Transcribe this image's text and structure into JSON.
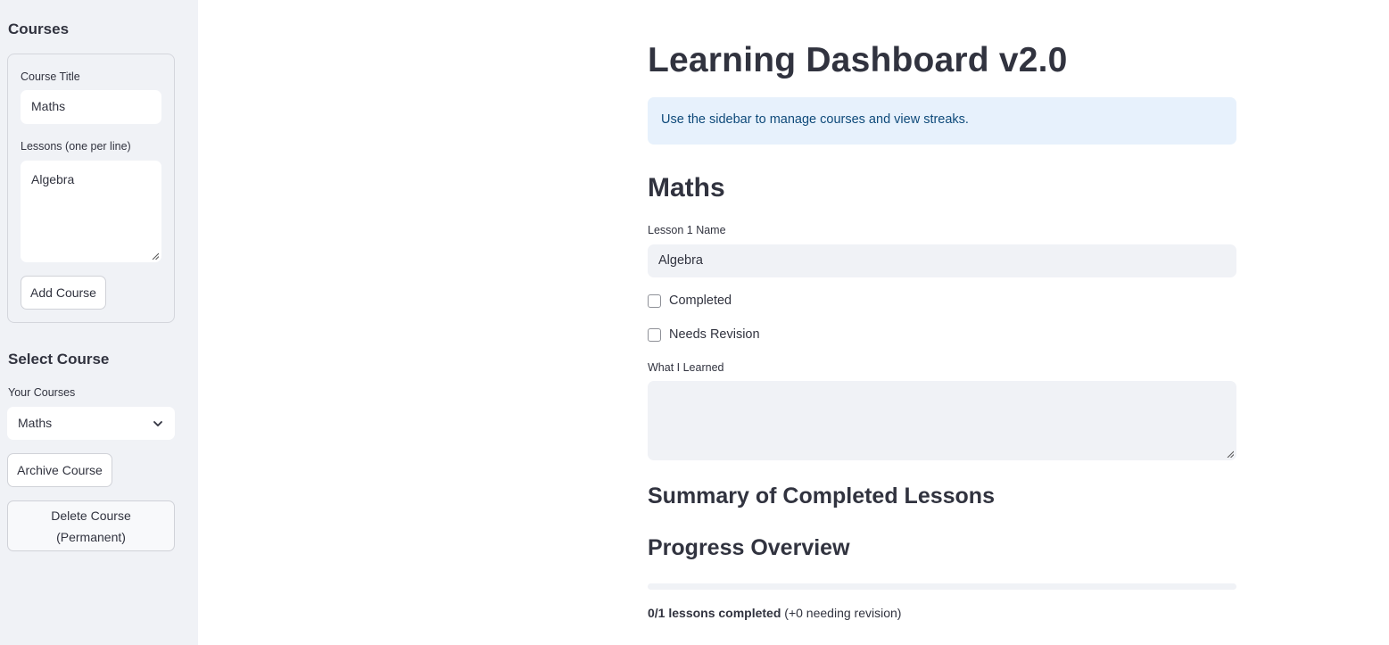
{
  "sidebar": {
    "courses_heading": "Courses",
    "form": {
      "course_title_label": "Course Title",
      "course_title_value": "Maths",
      "lessons_label": "Lessons (one per line)",
      "lessons_value": "Algebra",
      "add_button": "Add Course"
    },
    "select_heading": "Select Course",
    "your_courses_label": "Your Courses",
    "selected_course": "Maths",
    "archive_button": "Archive Course",
    "delete_button": "Delete Course (Permanent)"
  },
  "main": {
    "title": "Learning Dashboard v2.0",
    "info": "Use the sidebar to manage courses and view streaks.",
    "course_heading": "Maths",
    "lesson_name_label": "Lesson 1 Name",
    "lesson_name_value": "Algebra",
    "completed_label": "Completed",
    "needs_revision_label": "Needs Revision",
    "learned_label": "What I Learned",
    "learned_value": "",
    "summary_heading": "Summary of Completed Lessons",
    "progress_heading": "Progress Overview",
    "progress_fraction": 0,
    "progress_bold": "0/1 lessons completed",
    "progress_rest": " (+0 needing revision)"
  },
  "colors": {
    "sidebar_bg": "#f0f2f6",
    "info_bg": "#e7f1fc",
    "info_text": "#0f4a7a",
    "accent": "#ff4b4b"
  },
  "icons": {
    "select_chevron": "chevron-down-icon",
    "resize_grip": "resize-grip-icon"
  }
}
